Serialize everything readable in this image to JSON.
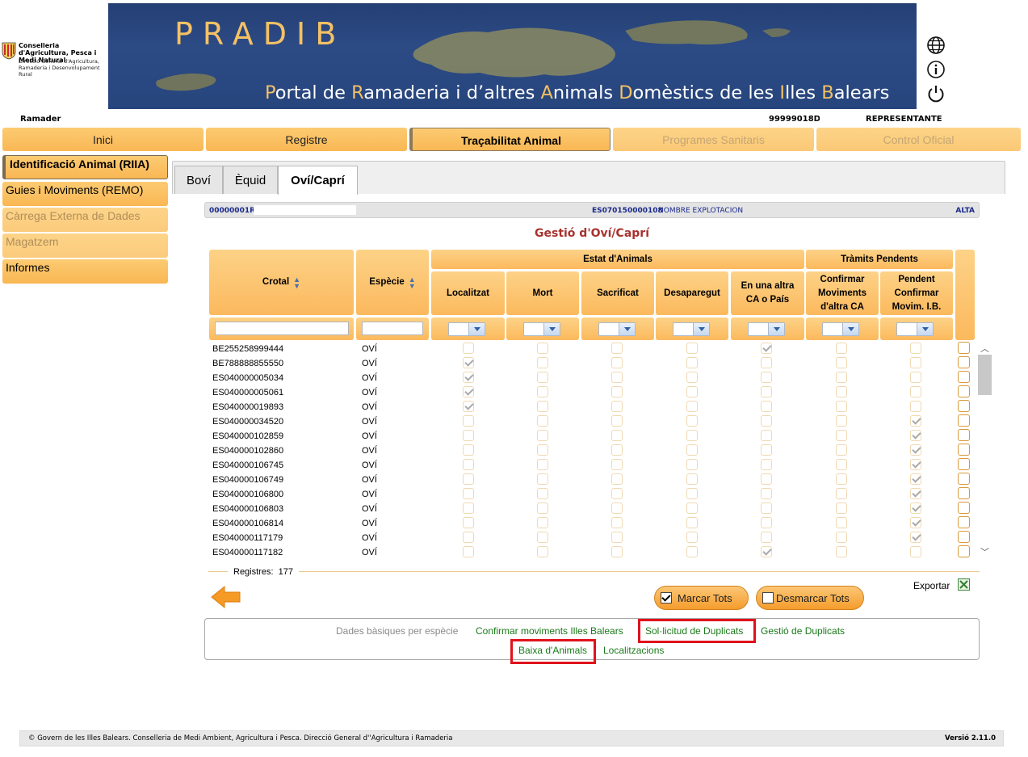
{
  "logo": {
    "line1": "Conselleria d'Agricultura, Pesca i Medi Natural",
    "line2": "Direcció General d'Agricultura, Ramaderia i Desenvolupament Rural"
  },
  "banner": {
    "title": "PRADIB",
    "subtitle_parts": [
      "P",
      "ortal de ",
      "R",
      "amaderia i d’altres ",
      "A",
      "nimals ",
      "D",
      "omèstics de les ",
      "I",
      "lles ",
      "B",
      "alears"
    ]
  },
  "user": {
    "role": "Ramader",
    "id": "99999018D -",
    "type": "REPRESENTANTE"
  },
  "nav": [
    {
      "label": "Inici",
      "state": "normal"
    },
    {
      "label": "Registre",
      "state": "normal"
    },
    {
      "label": "Traçabilitat Animal",
      "state": "active"
    },
    {
      "label": "Programes Sanitaris",
      "state": "disabled"
    },
    {
      "label": "Control Oficial",
      "state": "disabled"
    }
  ],
  "sidebar": [
    {
      "label": "Identificació Animal (RIIA)",
      "state": "active"
    },
    {
      "label": "Guies i Moviments (REMO)",
      "state": "normal"
    },
    {
      "label": "Càrrega Externa de Dades",
      "state": "disabled"
    },
    {
      "label": "Magatzem",
      "state": "disabled"
    },
    {
      "label": "Informes",
      "state": "normal"
    }
  ],
  "subtabs": [
    {
      "label": "Boví",
      "active": false
    },
    {
      "label": "Èquid",
      "active": false
    },
    {
      "label": "Oví/Caprí",
      "active": true
    }
  ],
  "info": {
    "code": "00000001R",
    "explotacion_code": "ES070150000108",
    "explotacion_name": "NOMBRE EXPLOTACION",
    "status": "ALTA"
  },
  "section_title": "Gestió d'Oví/Caprí",
  "table": {
    "col_crotal": "Crotal",
    "col_especie": "Espècie",
    "group_estat": "Estat d'Animals",
    "group_tramits": "Tràmits Pendents",
    "col_localitzat": "Localitzat",
    "col_mort": "Mort",
    "col_sacrificat": "Sacrificat",
    "col_desaparegut": "Desaparegut",
    "col_altra_ca": "En una altra CA o País",
    "col_conf_mov": "Confirmar Moviments d'altra CA",
    "col_pend_conf": "Pendent Confirmar Movim. I.B.",
    "rows": [
      {
        "crotal": "BE255258999444",
        "esp": "OVÍ",
        "flags": [
          0,
          0,
          0,
          0,
          1,
          0,
          0
        ]
      },
      {
        "crotal": "BE788888855550",
        "esp": "OVÍ",
        "flags": [
          1,
          0,
          0,
          0,
          0,
          0,
          0
        ]
      },
      {
        "crotal": "ES040000005034",
        "esp": "OVÍ",
        "flags": [
          1,
          0,
          0,
          0,
          0,
          0,
          0
        ]
      },
      {
        "crotal": "ES040000005061",
        "esp": "OVÍ",
        "flags": [
          1,
          0,
          0,
          0,
          0,
          0,
          0
        ]
      },
      {
        "crotal": "ES040000019893",
        "esp": "OVÍ",
        "flags": [
          1,
          0,
          0,
          0,
          0,
          0,
          0
        ]
      },
      {
        "crotal": "ES040000034520",
        "esp": "OVÍ",
        "flags": [
          0,
          0,
          0,
          0,
          0,
          0,
          1
        ]
      },
      {
        "crotal": "ES040000102859",
        "esp": "OVÍ",
        "flags": [
          0,
          0,
          0,
          0,
          0,
          0,
          1
        ]
      },
      {
        "crotal": "ES040000102860",
        "esp": "OVÍ",
        "flags": [
          0,
          0,
          0,
          0,
          0,
          0,
          1
        ]
      },
      {
        "crotal": "ES040000106745",
        "esp": "OVÍ",
        "flags": [
          0,
          0,
          0,
          0,
          0,
          0,
          1
        ]
      },
      {
        "crotal": "ES040000106749",
        "esp": "OVÍ",
        "flags": [
          0,
          0,
          0,
          0,
          0,
          0,
          1
        ]
      },
      {
        "crotal": "ES040000106800",
        "esp": "OVÍ",
        "flags": [
          0,
          0,
          0,
          0,
          0,
          0,
          1
        ]
      },
      {
        "crotal": "ES040000106803",
        "esp": "OVÍ",
        "flags": [
          0,
          0,
          0,
          0,
          0,
          0,
          1
        ]
      },
      {
        "crotal": "ES040000106814",
        "esp": "OVÍ",
        "flags": [
          0,
          0,
          0,
          0,
          0,
          0,
          1
        ]
      },
      {
        "crotal": "ES040000117179",
        "esp": "OVÍ",
        "flags": [
          0,
          0,
          0,
          0,
          0,
          0,
          1
        ]
      },
      {
        "crotal": "ES040000117182",
        "esp": "OVÍ",
        "flags": [
          0,
          0,
          0,
          0,
          1,
          0,
          0
        ]
      }
    ]
  },
  "registres_label": "Registres:",
  "registres_count": "177",
  "buttons": {
    "marcar": "Marcar Tots",
    "desmarcar": "Desmarcar Tots",
    "exportar": "Exportar"
  },
  "links": {
    "dades_basiques": "Dades bàsiques per espècie",
    "confirmar": "Confirmar moviments Illes Balears",
    "solicitud": "Sol·licitud de Duplicats",
    "gestio": "Gestió de Duplicats",
    "baixa": "Baixa d'Animals",
    "localitzacions": "Localitzacions"
  },
  "footer": {
    "text": "© Govern de les Illes Balears. Conselleria de Medi Ambient, Agricultura i Pesca. Direcció General d''Agricultura i Ramaderia",
    "version": "Versió 2.11.0"
  },
  "colors": {
    "banner_bg": "#27457d",
    "accent_orange": "#f9b754",
    "title_red": "#a8322e",
    "link_green": "#1a7a1a",
    "highlight_red": "#e0121c"
  }
}
